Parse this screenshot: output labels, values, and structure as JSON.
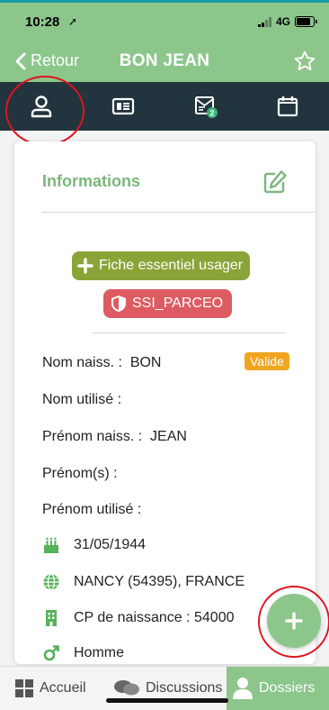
{
  "status_bar": {
    "time": "10:28",
    "network": "4G"
  },
  "nav": {
    "back_label": "Retour",
    "title": "BON JEAN"
  },
  "tabs": [
    {
      "icon": "user-icon"
    },
    {
      "icon": "id-card-icon"
    },
    {
      "icon": "mail-badge-icon",
      "badge": "2"
    },
    {
      "icon": "calendar-icon"
    }
  ],
  "informations": {
    "title": "Informations",
    "fiche_button": "Fiche essentiel usager",
    "ssi_button": "SSI_PARCEO",
    "fields": {
      "nom_naiss_label": "Nom naiss. :",
      "nom_naiss_value": "BON",
      "status": "Valide",
      "nom_utilise": "Nom utilisé :",
      "prenom_naiss_label": "Prénom naiss. :",
      "prenom_naiss_value": "JEAN",
      "prenoms": "Prénom(s) :",
      "prenom_utilise": "Prénom utilisé :"
    },
    "birth_date": "31/05/1944",
    "birth_place": "NANCY (54395), FRANCE",
    "cp_naissance": "CP de naissance : 54000",
    "sex": "Homme"
  },
  "bottom_nav": {
    "accueil": "Accueil",
    "discussion": "Discussions",
    "dossiers": "Dossiers"
  },
  "colors": {
    "accent_green": "#8cc68b",
    "tab_bar": "#22343d",
    "fiche_olive": "#8aa437",
    "ssi_red": "#dd5c62",
    "badge_orange": "#f0a521",
    "highlight_red": "#e0141e"
  }
}
